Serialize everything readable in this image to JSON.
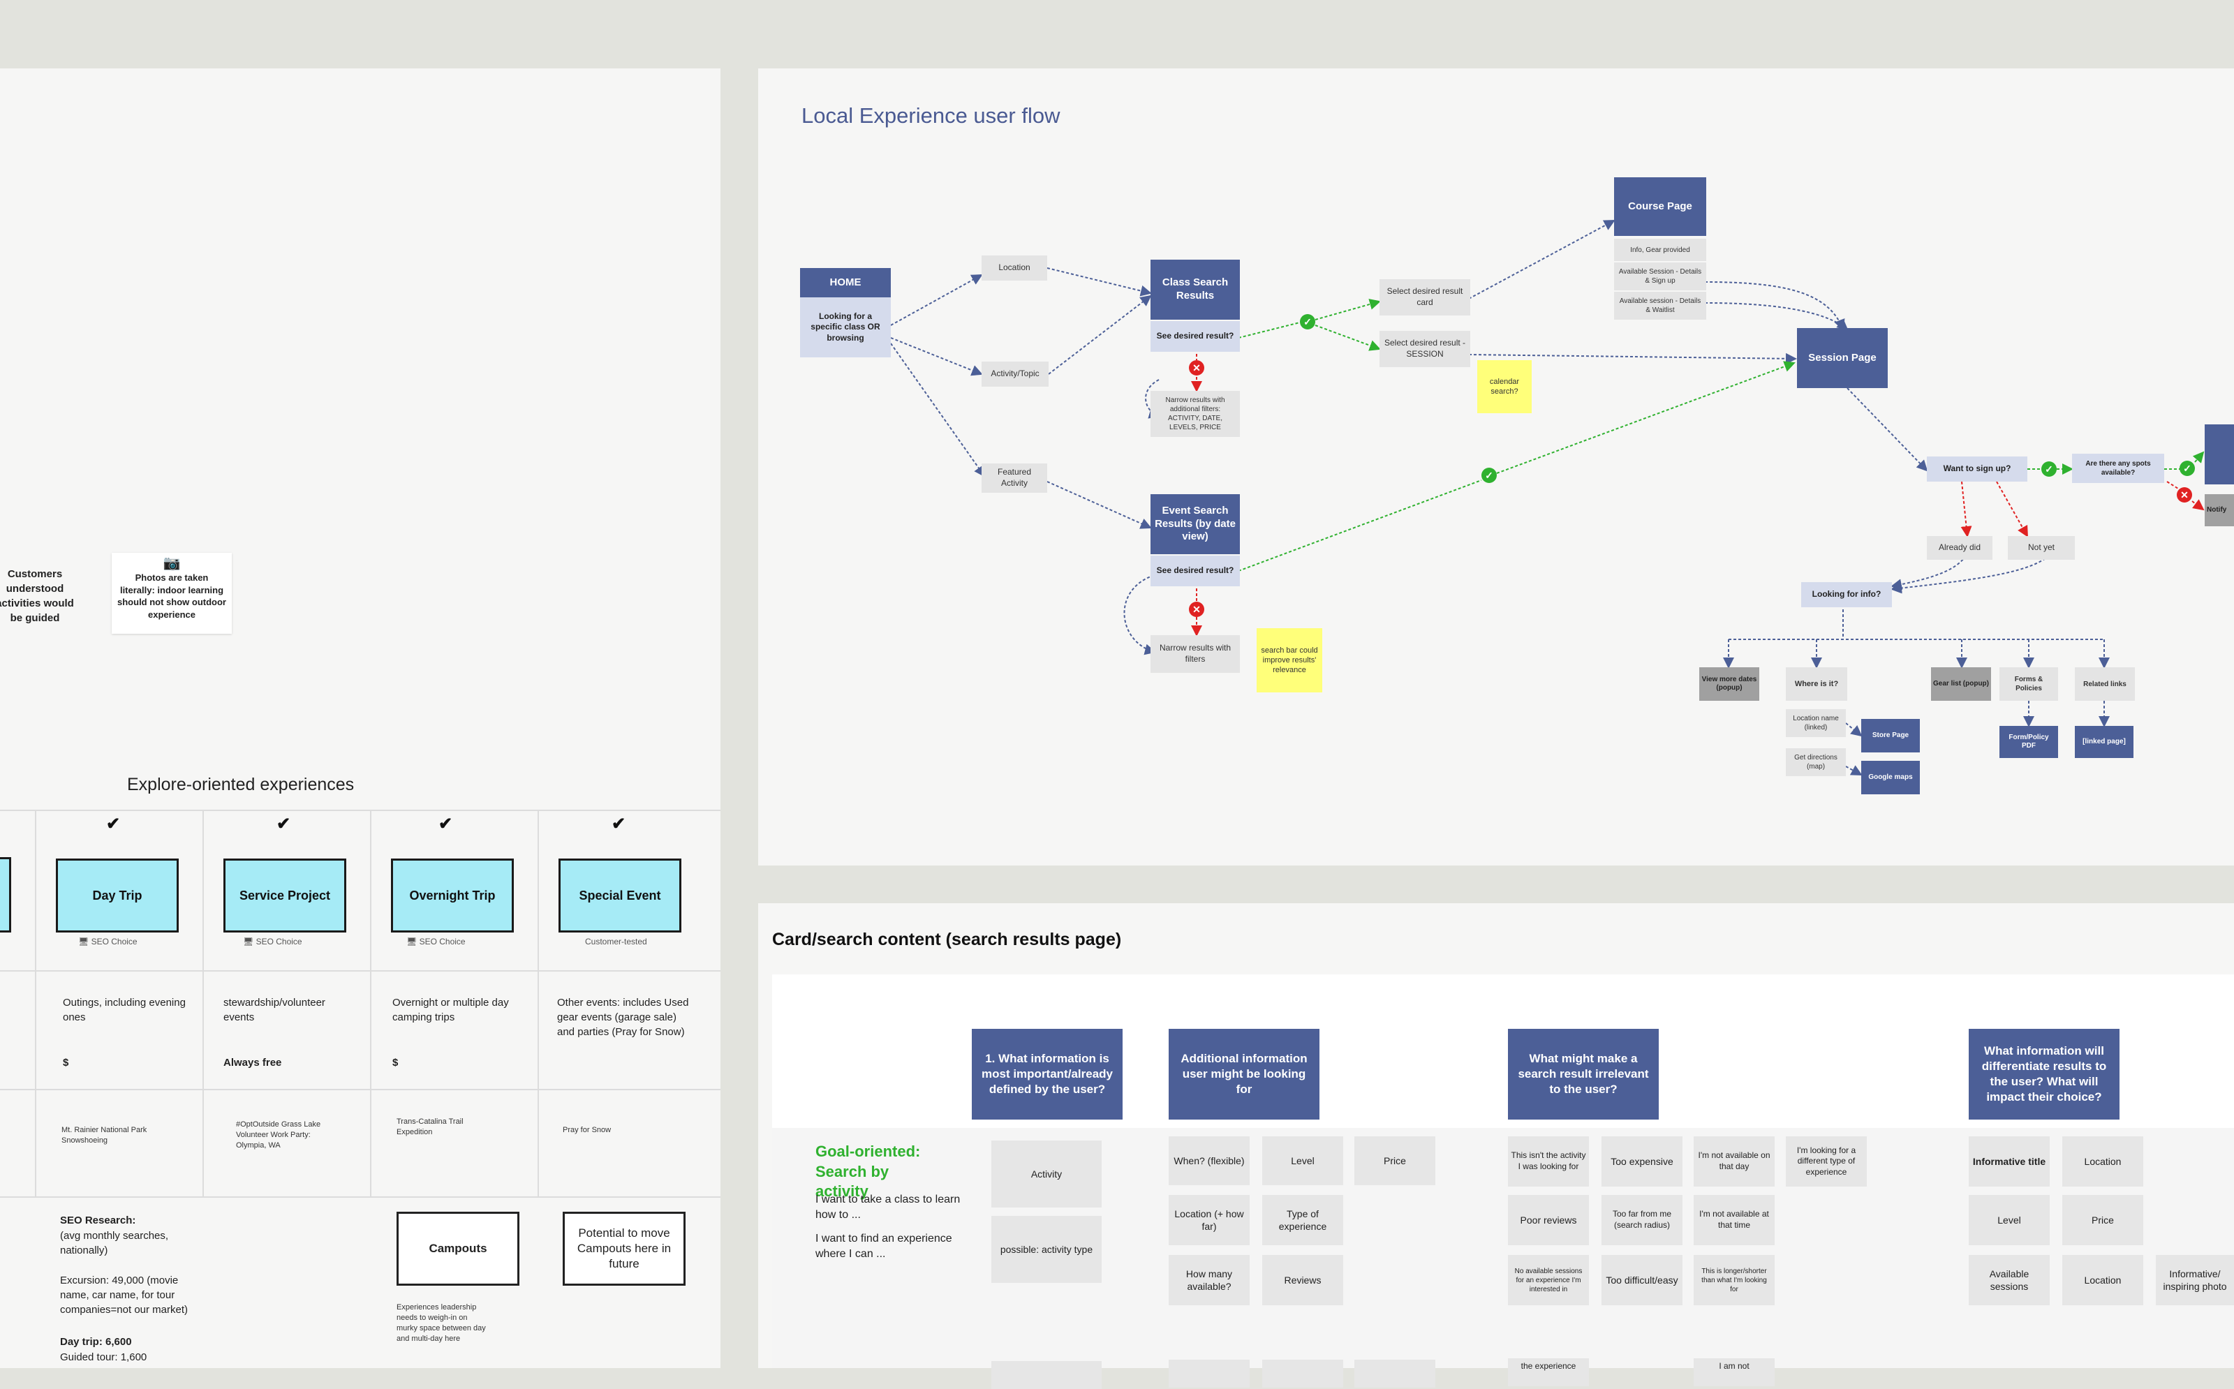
{
  "left_board": {
    "notes": {
      "customers": "Customers understood activities would be guided",
      "photos": "Photos are taken literally: indoor learning should not show outdoor experience"
    },
    "section_title": "Explore-oriented experiences",
    "cards": [
      {
        "title": "Day Trip",
        "tag": "SEO Choice",
        "desc": "Outings, including evening ones",
        "price": "$",
        "example": "Mt. Rainier National Park Snowshoeing"
      },
      {
        "title": "Service Project",
        "tag": "SEO Choice",
        "desc": "stewardship/volunteer events",
        "price": "Always free",
        "example": "#OptOutside Grass Lake Volunteer Work Party: Olympia, WA"
      },
      {
        "title": "Overnight Trip",
        "tag": "SEO Choice",
        "desc": "Overnight or multiple day camping trips",
        "price": "$",
        "example": "Trans-Catalina Trail Expedition"
      },
      {
        "title": "Special Event",
        "tag": "Customer-tested",
        "desc": "Other events: includes Used gear events (garage sale) and parties (Pray for Snow)",
        "price": "",
        "example": "Pray for Snow"
      }
    ],
    "seo": {
      "title": "SEO Research:",
      "sub": "(avg monthly searches, nationally)",
      "excursion": "Excursion: 49,000 (movie name, car name, for tour companies=not our market)",
      "daytrip": "Day trip: 6,600",
      "guided": "Guided tour: 1,600"
    },
    "campouts": {
      "title": "Campouts",
      "note": "Experiences leadership needs to weigh-in on murky space between day and multi-day here",
      "potential": "Potential to move Campouts here in future"
    }
  },
  "flow": {
    "title": "Local Experience user flow",
    "home": {
      "title": "HOME",
      "desc": "Looking for a specific class OR browsing"
    },
    "location": "Location",
    "activity_topic": "Activity/Topic",
    "featured": "Featured Activity",
    "class_results": "Class Search Results",
    "see_desired_1": "See desired result?",
    "narrow_1": "Narrow results with additional filters: ACTIVITY, DATE, LEVELS, PRICE",
    "event_results": "Event Search Results (by date view)",
    "see_desired_2": "See desired result?",
    "narrow_2": "Narrow results with filters",
    "search_note": "search bar could improve results' relevance",
    "select_card": "Select desired result card",
    "select_session": "Select desired result - SESSION",
    "calendar_note": "calendar search?",
    "course_page": "Course Page",
    "course_items": [
      "Info, Gear provided",
      "Available Session - Details & Sign up",
      "Available session - Details & Waitlist"
    ],
    "session_page": "Session Page",
    "want_signup": "Want to sign up?",
    "spots": "Are there any spots available?",
    "notify": "Notify",
    "already_did": "Already did",
    "not_yet": "Not yet",
    "looking_info": "Looking for info?",
    "view_more": "View more dates (popup)",
    "where": "Where is it?",
    "gear_list": "Gear list (popup)",
    "forms": "Forms & Policies",
    "related": "Related links",
    "location_name": "Location name (linked)",
    "directions": "Get directions (map)",
    "store_page": "Store Page",
    "google_maps": "Google maps",
    "form_pdf": "Form/Policy PDF",
    "linked_page": "[linked page]"
  },
  "card_search": {
    "title": "Card/search content (search results page)",
    "goal_title": "Goal-oriented: Search by activity",
    "goal_1": "I want to take a class to learn how to ...",
    "goal_2": "I want to find an experience where I can ...",
    "headers": [
      "1. What information is most important/already defined by the user?",
      "Additional information user might be looking for",
      "What might make a search result irrelevant to the user?",
      "What information will differentiate results to the user? What will impact their choice?"
    ],
    "col1": [
      "Activity",
      "possible: activity type"
    ],
    "col2": [
      "When? (flexible)",
      "Level",
      "Price",
      "Location (+ how far)",
      "Type of experience",
      "How many available?",
      "Reviews"
    ],
    "col3": [
      "This isn't the activity I was looking for",
      "Too expensive",
      "I'm not available on that day",
      "I'm looking for a different type of experience",
      "Poor reviews",
      "Too far from me (search radius)",
      "I'm not available at that time",
      "No available sessions for an experience I'm interested in",
      "Too difficult/easy",
      "This is longer/shorter than what I'm looking for"
    ],
    "col4": [
      "Informative title",
      "Location",
      "Level",
      "Price",
      "Available sessions",
      "Location",
      "Informative/ inspiring photo"
    ],
    "partial": [
      "the experience",
      "I am not"
    ]
  },
  "colors": {
    "node_blue": "#4c5f97",
    "light_blue": "#d5dbec",
    "yes_green": "#2fb12f",
    "no_red": "#e02222",
    "sticky_yellow": "#ffff7a",
    "cyan_card": "#a6ebf6"
  }
}
